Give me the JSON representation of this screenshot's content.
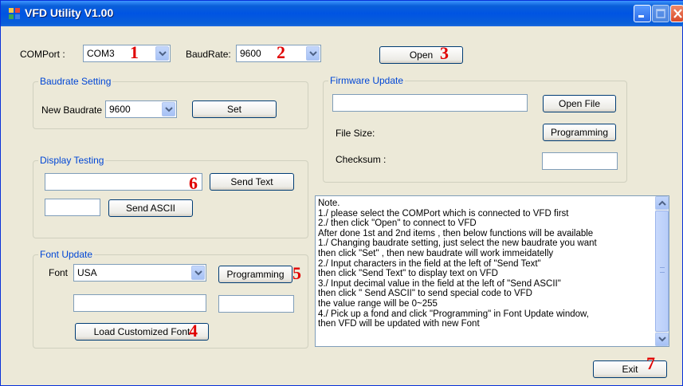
{
  "window": {
    "title": "VFD Utility V1.00",
    "accent_color": "#0054e3"
  },
  "connection": {
    "comport_label": "COMPort :",
    "comport_value": "COM3",
    "baudrate_label": "BaudRate:",
    "baudrate_value": "9600",
    "open_button": "Open"
  },
  "baudrate_setting": {
    "title": "Baudrate Setting",
    "new_baudrate_label": "New Baudrate",
    "new_baudrate_value": "9600",
    "set_button": "Set"
  },
  "display_testing": {
    "title": "Display Testing",
    "send_text_value": "",
    "send_text_button": "Send Text",
    "send_ascii_value": "",
    "send_ascii_button": "Send ASCII"
  },
  "font_update": {
    "title": "Font Update",
    "font_label": "Font",
    "font_value": "USA",
    "programming_button": "Programming",
    "load_button": "Load Customized Font"
  },
  "firmware_update": {
    "title": "Firmware Update",
    "file_path_value": "",
    "open_file_button": "Open File",
    "file_size_label": "File Size:",
    "programming_button": "Programming",
    "checksum_label": "Checksum :",
    "checksum_value": ""
  },
  "notes": {
    "lines": [
      "Note.",
      "1./ please select the COMPort which is connected to VFD first",
      "2./ then click \"Open\" to connect to VFD",
      "After done 1st and 2nd items , then below functions will be available",
      "1./ Changing baudrate setting, just select the new baudrate you want",
      "then click \"Set\" , then new baudrate will work immeidatelly",
      "2./ Input characters in the field at the left of \"Send Text\"",
      "then click \"Send Text\" to display text on VFD",
      "3./ Input decimal value in the field at the left of \"Send ASCII\"",
      "then click \" Send ASCII\" to send special code to VFD",
      "the value range will be 0~255",
      "4./ Pick up a fond and click \"Programming\" in Font Update window,",
      "then VFD will be updated with new Font"
    ]
  },
  "exit_button": "Exit",
  "step_markers": [
    "1",
    "2",
    "3",
    "4",
    "5",
    "6",
    "7"
  ],
  "marker_color": "#e00000"
}
